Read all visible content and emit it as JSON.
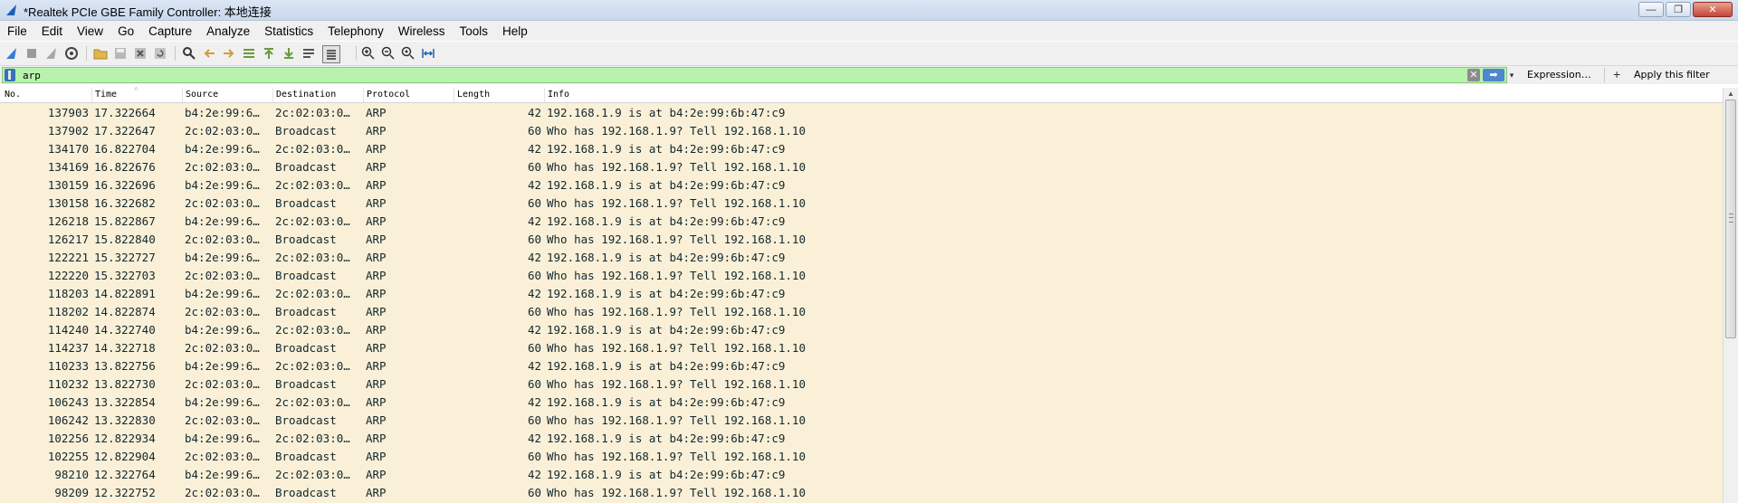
{
  "window": {
    "title": "*Realtek PCIe GBE Family Controller: 本地连接",
    "controls": {
      "minimize": "—",
      "maximize": "❐",
      "close": "✕"
    }
  },
  "menu": [
    {
      "label": "File"
    },
    {
      "label": "Edit"
    },
    {
      "label": "View"
    },
    {
      "label": "Go"
    },
    {
      "label": "Capture"
    },
    {
      "label": "Analyze"
    },
    {
      "label": "Statistics"
    },
    {
      "label": "Telephony"
    },
    {
      "label": "Wireless"
    },
    {
      "label": "Tools"
    },
    {
      "label": "Help"
    }
  ],
  "filter": {
    "value": "arp",
    "expression_label": "Expression…",
    "plus": "+",
    "apply_label": "Apply this filter",
    "clear_glyph": "✕",
    "apply_glyph": "➡",
    "dropdown_glyph": "▾"
  },
  "columns": {
    "no": "No.",
    "time": "Time",
    "source": "Source",
    "destination": "Destination",
    "protocol": "Protocol",
    "length": "Length",
    "info": "Info"
  },
  "packets": [
    {
      "no": "137903",
      "time": "17.322664",
      "source": "b4:2e:99:6…",
      "destination": "2c:02:03:0…",
      "protocol": "ARP",
      "length": "42",
      "info": "192.168.1.9 is at b4:2e:99:6b:47:c9"
    },
    {
      "no": "137902",
      "time": "17.322647",
      "source": "2c:02:03:0…",
      "destination": "Broadcast",
      "protocol": "ARP",
      "length": "60",
      "info": "Who has 192.168.1.9? Tell 192.168.1.10"
    },
    {
      "no": "134170",
      "time": "16.822704",
      "source": "b4:2e:99:6…",
      "destination": "2c:02:03:0…",
      "protocol": "ARP",
      "length": "42",
      "info": "192.168.1.9 is at b4:2e:99:6b:47:c9"
    },
    {
      "no": "134169",
      "time": "16.822676",
      "source": "2c:02:03:0…",
      "destination": "Broadcast",
      "protocol": "ARP",
      "length": "60",
      "info": "Who has 192.168.1.9? Tell 192.168.1.10"
    },
    {
      "no": "130159",
      "time": "16.322696",
      "source": "b4:2e:99:6…",
      "destination": "2c:02:03:0…",
      "protocol": "ARP",
      "length": "42",
      "info": "192.168.1.9 is at b4:2e:99:6b:47:c9"
    },
    {
      "no": "130158",
      "time": "16.322682",
      "source": "2c:02:03:0…",
      "destination": "Broadcast",
      "protocol": "ARP",
      "length": "60",
      "info": "Who has 192.168.1.9? Tell 192.168.1.10"
    },
    {
      "no": "126218",
      "time": "15.822867",
      "source": "b4:2e:99:6…",
      "destination": "2c:02:03:0…",
      "protocol": "ARP",
      "length": "42",
      "info": "192.168.1.9 is at b4:2e:99:6b:47:c9"
    },
    {
      "no": "126217",
      "time": "15.822840",
      "source": "2c:02:03:0…",
      "destination": "Broadcast",
      "protocol": "ARP",
      "length": "60",
      "info": "Who has 192.168.1.9? Tell 192.168.1.10"
    },
    {
      "no": "122221",
      "time": "15.322727",
      "source": "b4:2e:99:6…",
      "destination": "2c:02:03:0…",
      "protocol": "ARP",
      "length": "42",
      "info": "192.168.1.9 is at b4:2e:99:6b:47:c9"
    },
    {
      "no": "122220",
      "time": "15.322703",
      "source": "2c:02:03:0…",
      "destination": "Broadcast",
      "protocol": "ARP",
      "length": "60",
      "info": "Who has 192.168.1.9? Tell 192.168.1.10"
    },
    {
      "no": "118203",
      "time": "14.822891",
      "source": "b4:2e:99:6…",
      "destination": "2c:02:03:0…",
      "protocol": "ARP",
      "length": "42",
      "info": "192.168.1.9 is at b4:2e:99:6b:47:c9"
    },
    {
      "no": "118202",
      "time": "14.822874",
      "source": "2c:02:03:0…",
      "destination": "Broadcast",
      "protocol": "ARP",
      "length": "60",
      "info": "Who has 192.168.1.9? Tell 192.168.1.10"
    },
    {
      "no": "114240",
      "time": "14.322740",
      "source": "b4:2e:99:6…",
      "destination": "2c:02:03:0…",
      "protocol": "ARP",
      "length": "42",
      "info": "192.168.1.9 is at b4:2e:99:6b:47:c9"
    },
    {
      "no": "114237",
      "time": "14.322718",
      "source": "2c:02:03:0…",
      "destination": "Broadcast",
      "protocol": "ARP",
      "length": "60",
      "info": "Who has 192.168.1.9? Tell 192.168.1.10"
    },
    {
      "no": "110233",
      "time": "13.822756",
      "source": "b4:2e:99:6…",
      "destination": "2c:02:03:0…",
      "protocol": "ARP",
      "length": "42",
      "info": "192.168.1.9 is at b4:2e:99:6b:47:c9"
    },
    {
      "no": "110232",
      "time": "13.822730",
      "source": "2c:02:03:0…",
      "destination": "Broadcast",
      "protocol": "ARP",
      "length": "60",
      "info": "Who has 192.168.1.9? Tell 192.168.1.10"
    },
    {
      "no": "106243",
      "time": "13.322854",
      "source": "b4:2e:99:6…",
      "destination": "2c:02:03:0…",
      "protocol": "ARP",
      "length": "42",
      "info": "192.168.1.9 is at b4:2e:99:6b:47:c9"
    },
    {
      "no": "106242",
      "time": "13.322830",
      "source": "2c:02:03:0…",
      "destination": "Broadcast",
      "protocol": "ARP",
      "length": "60",
      "info": "Who has 192.168.1.9? Tell 192.168.1.10"
    },
    {
      "no": "102256",
      "time": "12.822934",
      "source": "b4:2e:99:6…",
      "destination": "2c:02:03:0…",
      "protocol": "ARP",
      "length": "42",
      "info": "192.168.1.9 is at b4:2e:99:6b:47:c9"
    },
    {
      "no": "102255",
      "time": "12.822904",
      "source": "2c:02:03:0…",
      "destination": "Broadcast",
      "protocol": "ARP",
      "length": "60",
      "info": "Who has 192.168.1.9? Tell 192.168.1.10"
    },
    {
      "no": "98210",
      "time": "12.322764",
      "source": "b4:2e:99:6…",
      "destination": "2c:02:03:0…",
      "protocol": "ARP",
      "length": "42",
      "info": "192.168.1.9 is at b4:2e:99:6b:47:c9"
    },
    {
      "no": "98209",
      "time": "12.322752",
      "source": "2c:02:03:0…",
      "destination": "Broadcast",
      "protocol": "ARP",
      "length": "60",
      "info": "Who has 192.168.1.9? Tell 192.168.1.10"
    }
  ],
  "colors": {
    "row_background": "#faf0d7",
    "row_text": "#12272e",
    "filter_valid_bg": "#b9f2ae"
  }
}
